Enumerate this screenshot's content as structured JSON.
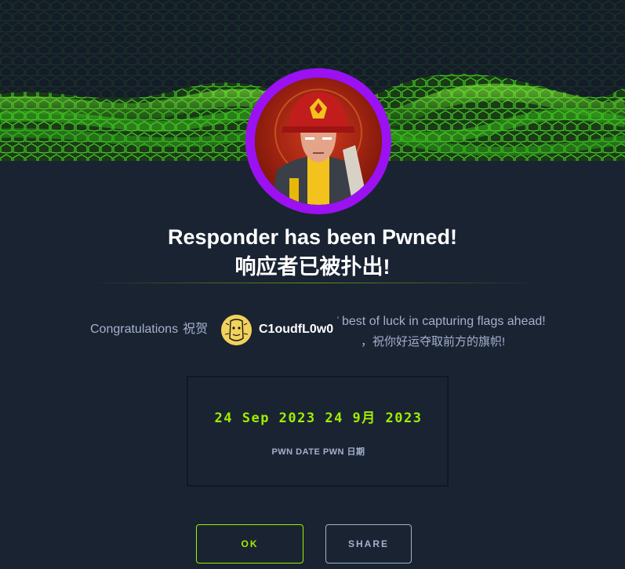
{
  "modal": {
    "title": "Responder has been Pwned!",
    "subtitle": "响应者已被扑出!",
    "congrats_label": "Congratulations",
    "congrats_label_cn": "祝贺",
    "username": "C1oudfL0w0",
    "username_suffix": "'",
    "luck_message": "best of luck in capturing flags ahead!",
    "luck_message_cn": "，祝你好运夺取前方的旗帜!",
    "pwn_date": "24 Sep 2023 24 9月 2023",
    "pwn_date_label": "PWN DATE PWN 日期",
    "ok_label": "OK",
    "share_label": "SHARE"
  },
  "icons": {
    "machine_avatar": "firefighter-avatar-icon",
    "user_avatar": "user-avatar-icon"
  },
  "colors": {
    "background": "#1a2332",
    "accent_green": "#9fef00",
    "avatar_ring": "#9b11f2",
    "muted_text": "#a4b1cd"
  }
}
